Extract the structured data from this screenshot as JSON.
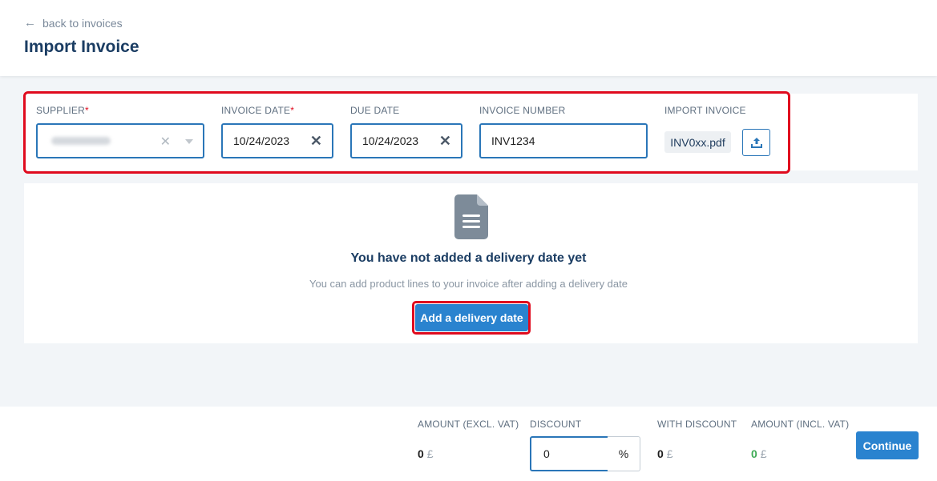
{
  "header": {
    "back_label": "back to invoices",
    "title": "Import Invoice"
  },
  "form": {
    "supplier": {
      "label": "SUPPLIER",
      "required_mark": "*",
      "value_redacted": true
    },
    "invoice_date": {
      "label": "INVOICE DATE",
      "required_mark": "*",
      "value": "10/24/2023"
    },
    "due_date": {
      "label": "DUE DATE",
      "value": "10/24/2023"
    },
    "invoice_number": {
      "label": "INVOICE NUMBER",
      "value": "INV1234"
    },
    "import_invoice": {
      "label": "IMPORT INVOICE",
      "file_name": "INV0xx.pdf"
    }
  },
  "empty_state": {
    "title": "You have not added a delivery date yet",
    "subtitle": "You can add product lines to your invoice after adding a delivery date",
    "button_label": "Add a delivery date"
  },
  "footer": {
    "amount_excl": {
      "label": "AMOUNT (EXCL. VAT)",
      "value": "0",
      "currency": "£"
    },
    "discount": {
      "label": "DISCOUNT",
      "value": "0",
      "unit": "%"
    },
    "with_discount": {
      "label": "WITH DISCOUNT",
      "value": "0",
      "currency": "£"
    },
    "amount_incl": {
      "label": "AMOUNT (INCL. VAT)",
      "value": "0",
      "currency": "£"
    },
    "continue_label": "Continue"
  },
  "colors": {
    "accent": "#2a83cf",
    "highlight": "#e00b1e",
    "title": "#1b3d63",
    "positive": "#3eaa55"
  },
  "icons": [
    "arrow-left-icon",
    "clear-x-icon",
    "dropdown-caret-icon",
    "upload-icon",
    "document-icon"
  ]
}
